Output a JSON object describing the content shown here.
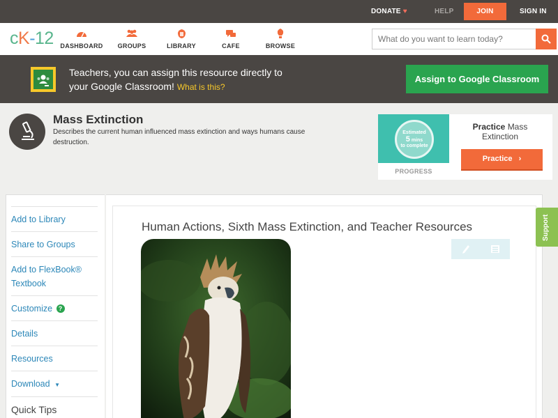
{
  "topbar": {
    "donate": "DONATE",
    "help": "HELP",
    "join": "JOIN",
    "signin": "SIGN IN"
  },
  "nav": {
    "logo": {
      "c": "c",
      "k": "K",
      "dash": "-",
      "num": "12"
    },
    "items": [
      {
        "label": "DASHBOARD",
        "icon": "dashboard-icon"
      },
      {
        "label": "GROUPS",
        "icon": "groups-icon"
      },
      {
        "label": "LIBRARY",
        "icon": "library-icon"
      },
      {
        "label": "CAFE",
        "icon": "cafe-icon"
      },
      {
        "label": "BROWSE",
        "icon": "browse-icon"
      }
    ],
    "search_placeholder": "What do you want to learn today?"
  },
  "banner": {
    "line1": "Teachers, you can assign this resource directly to",
    "line2": "your Google Classroom!",
    "what": "What is this?",
    "assign_button": "Assign to Google Classroom"
  },
  "concept": {
    "title": "Mass Extinction",
    "description": "Describes the current human influenced mass extinction and ways humans cause destruction."
  },
  "practice": {
    "estimated": "Estimated",
    "minutes": "5",
    "mins_label": "mins",
    "to_complete": "to complete",
    "progress_label": "PROGRESS",
    "title_bold": "Practice",
    "title_rest": "Mass Extinction",
    "button": "Practice"
  },
  "sidebar": {
    "items": [
      "Add to Library",
      "Share to Groups",
      "Add to FlexBook®",
      "Textbook",
      "Customize",
      "Details",
      "Resources",
      "Download"
    ],
    "tips": "Quick Tips"
  },
  "article": {
    "title": "Human Actions, Sixth Mass Extinction, and Teacher Resources"
  },
  "support": "Support",
  "colors": {
    "accent_orange": "#f26a3a",
    "classroom_green": "#2aa44f",
    "link_blue": "#2c87b8",
    "dark_bar": "#4a4643"
  }
}
